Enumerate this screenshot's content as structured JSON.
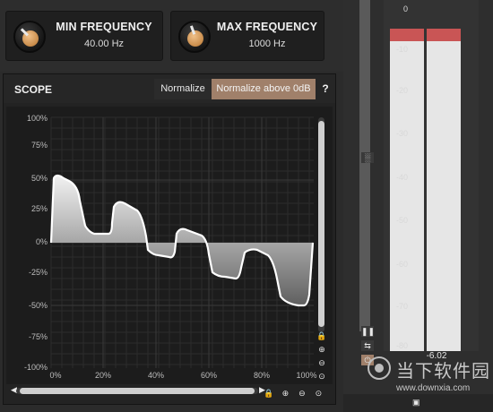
{
  "min_frequency": {
    "label": "MIN FREQUENCY",
    "value": "40.00 Hz"
  },
  "max_frequency": {
    "label": "MAX FREQUENCY",
    "value": "1000 Hz"
  },
  "scope": {
    "title": "SCOPE",
    "normalize_label": "Normalize",
    "normalize_above_label": "Normalize above 0dB",
    "help_label": "?",
    "y_ticks": [
      "100%",
      "75%",
      "50%",
      "25%",
      "0%",
      "-25%",
      "-50%",
      "-75%",
      "-100%"
    ],
    "x_ticks": [
      "0%",
      "20%",
      "40%",
      "60%",
      "80%",
      "100%"
    ]
  },
  "meter": {
    "db_ticks": [
      "0",
      "-10",
      "-20",
      "-30",
      "-40",
      "-50",
      "-60",
      "-70",
      "-80"
    ],
    "readout": "-6.02"
  },
  "watermark": {
    "text": "当下软件园",
    "url": "www.downxia.com"
  },
  "icons": [
    "lock-icon",
    "zoom-in-icon",
    "zoom-out-icon",
    "zoom-fit-icon",
    "scroll-left-arrow-icon",
    "scroll-right-arrow-icon",
    "pause-icon",
    "link-icon",
    "power-icon",
    "bar-chart-icon",
    "save-icon"
  ],
  "colors": {
    "accent_button": "#a0806a",
    "peak_red": "#c95555",
    "knob_cap": "#d49a5a"
  }
}
